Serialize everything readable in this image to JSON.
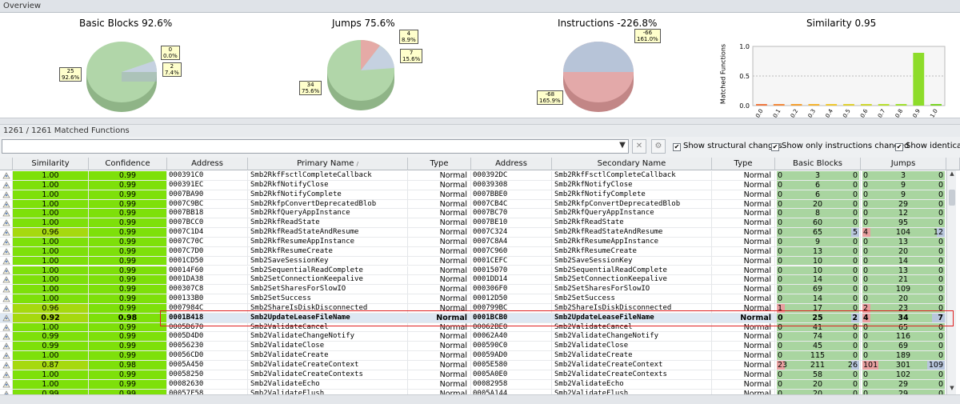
{
  "overview": {
    "title": "Overview",
    "charts": [
      {
        "title": "Basic Blocks 92.6%",
        "callouts": [
          [
            "0",
            "0.0%"
          ],
          [
            "2",
            "7.4%"
          ],
          [
            "25",
            "92.6%"
          ]
        ]
      },
      {
        "title": "Jumps 75.6%",
        "callouts": [
          [
            "4",
            "8.9%"
          ],
          [
            "7",
            "15.6%"
          ],
          [
            "34",
            "75.6%"
          ]
        ]
      },
      {
        "title": "Instructions -226.8%",
        "callouts": [
          [
            "-66",
            "161.0%"
          ],
          [
            "-68",
            "165.9%"
          ]
        ]
      },
      {
        "title": "Similarity 0.95"
      }
    ],
    "similarity_histogram": {
      "ylabel": "Matched Functions",
      "yticks": [
        "1.0",
        "0.5",
        "0.0"
      ],
      "xticks": [
        "0.0",
        "0.1",
        "0.2",
        "0.3",
        "0.4",
        "0.5",
        "0.6",
        "0.7",
        "0.8",
        "0.9",
        "1.0"
      ],
      "values": [
        0.02,
        0.02,
        0.02,
        0.02,
        0.02,
        0.02,
        0.02,
        0.02,
        0.02,
        1.0,
        0.02
      ],
      "colors": [
        "#f07840",
        "#f48a3c",
        "#f5a030",
        "#f5b430",
        "#f0c830",
        "#e0d030",
        "#cfd830",
        "#b8e030",
        "#a0e030",
        "#8ddc2a",
        "#7ad424"
      ]
    }
  },
  "matched": {
    "label": "1261 / 1261 Matched Functions"
  },
  "toolbar": {
    "filter_value": "",
    "clear_label": "✕",
    "settings_label": "⚙",
    "dropdown_label": "▼",
    "check_structural": "Show structural changes",
    "check_instructions": "Show only instructions changed",
    "check_identical": "Show identical"
  },
  "columns": [
    "Similarity",
    "Confidence",
    "Address",
    "Primary Name",
    "Type",
    "Address",
    "Secondary Name",
    "Type",
    "Basic Blocks",
    "Jumps"
  ],
  "sort_marker": "/",
  "rows": [
    {
      "sim": "1.00",
      "conf": "0.99",
      "a1": "000391C0",
      "n1": "Smb2RkfFsctlCompleteCallback",
      "t1": "Normal",
      "a2": "000392DC",
      "n2": "Smb2RkfFsctlCompleteCallback",
      "t2": "Normal",
      "bb": [
        "0",
        "3",
        "0"
      ],
      "jp": [
        "0",
        "3",
        "0"
      ]
    },
    {
      "sim": "1.00",
      "conf": "0.99",
      "a1": "000391EC",
      "n1": "Smb2RkfNotifyClose",
      "t1": "Normal",
      "a2": "00039308",
      "n2": "Smb2RkfNotifyClose",
      "t2": "Normal",
      "bb": [
        "0",
        "6",
        "0"
      ],
      "jp": [
        "0",
        "9",
        "0"
      ]
    },
    {
      "sim": "1.00",
      "conf": "0.99",
      "a1": "0007BA90",
      "n1": "Smb2RkfNotifyComplete",
      "t1": "Normal",
      "a2": "0007BBE0",
      "n2": "Smb2RkfNotifyComplete",
      "t2": "Normal",
      "bb": [
        "0",
        "6",
        "0"
      ],
      "jp": [
        "0",
        "9",
        "0"
      ]
    },
    {
      "sim": "1.00",
      "conf": "0.99",
      "a1": "0007C9BC",
      "n1": "Smb2RkfpConvertDeprecatedBlob",
      "t1": "Normal",
      "a2": "0007CB4C",
      "n2": "Smb2RkfpConvertDeprecatedBlob",
      "t2": "Normal",
      "bb": [
        "0",
        "20",
        "0"
      ],
      "jp": [
        "0",
        "29",
        "0"
      ]
    },
    {
      "sim": "1.00",
      "conf": "0.99",
      "a1": "0007BB18",
      "n1": "Smb2RkfQueryAppInstance",
      "t1": "Normal",
      "a2": "0007BC70",
      "n2": "Smb2RkfQueryAppInstance",
      "t2": "Normal",
      "bb": [
        "0",
        "8",
        "0"
      ],
      "jp": [
        "0",
        "12",
        "0"
      ]
    },
    {
      "sim": "1.00",
      "conf": "0.99",
      "a1": "0007BCC0",
      "n1": "Smb2RkfReadState",
      "t1": "Normal",
      "a2": "0007BE10",
      "n2": "Smb2RkfReadState",
      "t2": "Normal",
      "bb": [
        "0",
        "60",
        "0"
      ],
      "jp": [
        "0",
        "95",
        "0"
      ]
    },
    {
      "sim": "0.96",
      "conf": "0.99",
      "a1": "0007C1D4",
      "n1": "Smb2RkfReadStateAndResume",
      "t1": "Normal",
      "a2": "0007C324",
      "n2": "Smb2RkfReadStateAndResume",
      "t2": "Normal",
      "bb": [
        "0",
        "65",
        "5"
      ],
      "jp": [
        "4",
        "104",
        "12"
      ]
    },
    {
      "sim": "1.00",
      "conf": "0.99",
      "a1": "0007C70C",
      "n1": "Smb2RkfResumeAppInstance",
      "t1": "Normal",
      "a2": "0007C8A4",
      "n2": "Smb2RkfResumeAppInstance",
      "t2": "Normal",
      "bb": [
        "0",
        "9",
        "0"
      ],
      "jp": [
        "0",
        "13",
        "0"
      ]
    },
    {
      "sim": "1.00",
      "conf": "0.99",
      "a1": "0007C7D0",
      "n1": "Smb2RkfResumeCreate",
      "t1": "Normal",
      "a2": "0007C960",
      "n2": "Smb2RkfResumeCreate",
      "t2": "Normal",
      "bb": [
        "0",
        "13",
        "0"
      ],
      "jp": [
        "0",
        "20",
        "0"
      ]
    },
    {
      "sim": "1.00",
      "conf": "0.99",
      "a1": "0001CD50",
      "n1": "Smb2SaveSessionKey",
      "t1": "Normal",
      "a2": "0001CEFC",
      "n2": "Smb2SaveSessionKey",
      "t2": "Normal",
      "bb": [
        "0",
        "10",
        "0"
      ],
      "jp": [
        "0",
        "14",
        "0"
      ]
    },
    {
      "sim": "1.00",
      "conf": "0.99",
      "a1": "00014F60",
      "n1": "Smb2SequentialReadComplete",
      "t1": "Normal",
      "a2": "00015070",
      "n2": "Smb2SequentialReadComplete",
      "t2": "Normal",
      "bb": [
        "0",
        "10",
        "0"
      ],
      "jp": [
        "0",
        "13",
        "0"
      ]
    },
    {
      "sim": "1.00",
      "conf": "0.99",
      "a1": "0001DA38",
      "n1": "Smb2SetConnectionKeepalive",
      "t1": "Normal",
      "a2": "0001DD14",
      "n2": "Smb2SetConnectionKeepalive",
      "t2": "Normal",
      "bb": [
        "0",
        "14",
        "0"
      ],
      "jp": [
        "0",
        "21",
        "0"
      ]
    },
    {
      "sim": "1.00",
      "conf": "0.99",
      "a1": "000307C8",
      "n1": "Smb2SetSharesForSlowIO",
      "t1": "Normal",
      "a2": "000306F0",
      "n2": "Smb2SetSharesForSlowIO",
      "t2": "Normal",
      "bb": [
        "0",
        "69",
        "0"
      ],
      "jp": [
        "0",
        "109",
        "0"
      ]
    },
    {
      "sim": "1.00",
      "conf": "0.99",
      "a1": "000133B0",
      "n1": "Smb2SetSuccess",
      "t1": "Normal",
      "a2": "00012D50",
      "n2": "Smb2SetSuccess",
      "t2": "Normal",
      "bb": [
        "0",
        "14",
        "0"
      ],
      "jp": [
        "0",
        "20",
        "0"
      ]
    },
    {
      "sim": "0.96",
      "conf": "0.99",
      "a1": "0007984C",
      "n1": "Smb2ShareIsDiskDisconnected",
      "t1": "Normal",
      "a2": "000799BC",
      "n2": "Smb2ShareIsDiskDisconnected",
      "t2": "Normal",
      "bb": [
        "1",
        "17",
        "0"
      ],
      "jp": [
        "2",
        "23",
        "0"
      ]
    },
    {
      "sim": "0.92",
      "conf": "0.98",
      "a1": "0001B418",
      "n1": "Smb2UpdateLeaseFileName",
      "t1": "Normal",
      "a2": "0001BCB0",
      "n2": "Smb2UpdateLeaseFileName",
      "t2": "Normal",
      "bb": [
        "0",
        "25",
        "2"
      ],
      "jp": [
        "4",
        "34",
        "7"
      ],
      "selected": true
    },
    {
      "sim": "1.00",
      "conf": "0.99",
      "a1": "0005D670",
      "n1": "Smb2ValidateCancel",
      "t1": "Normal",
      "a2": "00062BE0",
      "n2": "Smb2ValidateCancel",
      "t2": "Normal",
      "bb": [
        "0",
        "41",
        "0"
      ],
      "jp": [
        "0",
        "65",
        "0"
      ]
    },
    {
      "sim": "0.99",
      "conf": "0.99",
      "a1": "0005D4D0",
      "n1": "Smb2ValidateChangeNotify",
      "t1": "Normal",
      "a2": "00062A40",
      "n2": "Smb2ValidateChangeNotify",
      "t2": "Normal",
      "bb": [
        "0",
        "74",
        "0"
      ],
      "jp": [
        "0",
        "116",
        "0"
      ]
    },
    {
      "sim": "0.99",
      "conf": "0.99",
      "a1": "00056230",
      "n1": "Smb2ValidateClose",
      "t1": "Normal",
      "a2": "000590C0",
      "n2": "Smb2ValidateClose",
      "t2": "Normal",
      "bb": [
        "0",
        "45",
        "0"
      ],
      "jp": [
        "0",
        "69",
        "0"
      ]
    },
    {
      "sim": "1.00",
      "conf": "0.99",
      "a1": "00056CD0",
      "n1": "Smb2ValidateCreate",
      "t1": "Normal",
      "a2": "00059AD0",
      "n2": "Smb2ValidateCreate",
      "t2": "Normal",
      "bb": [
        "0",
        "115",
        "0"
      ],
      "jp": [
        "0",
        "189",
        "0"
      ]
    },
    {
      "sim": "0.87",
      "conf": "0.98",
      "a1": "0005A450",
      "n1": "Smb2ValidateCreateContext",
      "t1": "Normal",
      "a2": "0005E580",
      "n2": "Smb2ValidateCreateContext",
      "t2": "Normal",
      "bb": [
        "23",
        "211",
        "26"
      ],
      "jp": [
        "101",
        "301",
        "109"
      ]
    },
    {
      "sim": "1.00",
      "conf": "0.99",
      "a1": "00058250",
      "n1": "Smb2ValidateCreateContexts",
      "t1": "Normal",
      "a2": "0005A0E0",
      "n2": "Smb2ValidateCreateContexts",
      "t2": "Normal",
      "bb": [
        "0",
        "58",
        "0"
      ],
      "jp": [
        "0",
        "102",
        "0"
      ]
    },
    {
      "sim": "1.00",
      "conf": "0.99",
      "a1": "00082630",
      "n1": "Smb2ValidateEcho",
      "t1": "Normal",
      "a2": "00082958",
      "n2": "Smb2ValidateEcho",
      "t2": "Normal",
      "bb": [
        "0",
        "20",
        "0"
      ],
      "jp": [
        "0",
        "29",
        "0"
      ]
    },
    {
      "sim": "0.99",
      "conf": "0.99",
      "a1": "00057F58",
      "n1": "Smb2ValidateFlush",
      "t1": "Normal",
      "a2": "0005A144",
      "n2": "Smb2ValidateFlush",
      "t2": "Normal",
      "bb": [
        "0",
        "20",
        "0"
      ],
      "jp": [
        "0",
        "29",
        "0"
      ]
    }
  ],
  "colors": {
    "sim_green": "#7ee00a",
    "sim_yellow": "#a6d90f",
    "bar_green": "#a9d5a0",
    "bar_red": "#e8a0a0",
    "bar_blue": "#b8c6dc",
    "selected": "#dde7f2"
  }
}
